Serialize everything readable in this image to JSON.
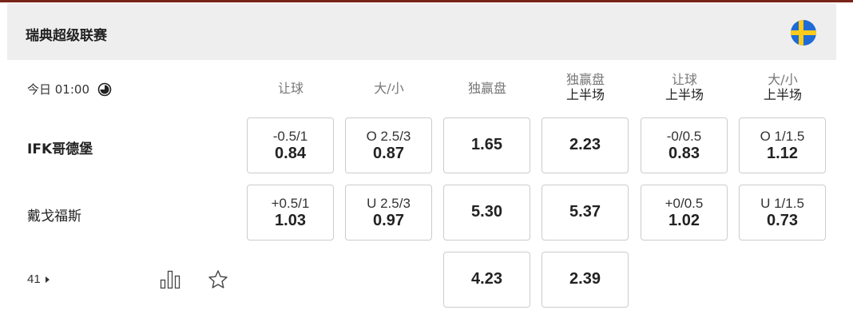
{
  "league": {
    "name": "瑞典超级联赛",
    "flag_icon": "sweden-flag-icon",
    "flag_colors": {
      "blue": "#1e6bd6",
      "yellow": "#fdcb1c"
    }
  },
  "match": {
    "time": "今日 01:00",
    "clock_icon": "clock-icon",
    "home_team": "IFK哥德堡",
    "away_team": "戴戈福斯",
    "more_count": "41",
    "stats_icon": "bar-chart-icon",
    "favorite_icon": "star-icon"
  },
  "columns": [
    {
      "label": "让球",
      "sub": ""
    },
    {
      "label": "大/小",
      "sub": ""
    },
    {
      "label": "独赢盘",
      "sub": ""
    },
    {
      "label": "独赢盘",
      "sub": "上半场"
    },
    {
      "label": "让球",
      "sub": "上半场"
    },
    {
      "label": "大/小",
      "sub": "上半场"
    }
  ],
  "odds": {
    "home": [
      {
        "line": "-0.5/1",
        "value": "0.84"
      },
      {
        "line": "O 2.5/3",
        "value": "0.87"
      },
      {
        "line": "",
        "value": "1.65"
      },
      {
        "line": "",
        "value": "2.23"
      },
      {
        "line": "-0/0.5",
        "value": "0.83"
      },
      {
        "line": "O 1/1.5",
        "value": "1.12"
      }
    ],
    "away": [
      {
        "line": "+0.5/1",
        "value": "1.03"
      },
      {
        "line": "U 2.5/3",
        "value": "0.97"
      },
      {
        "line": "",
        "value": "5.30"
      },
      {
        "line": "",
        "value": "5.37"
      },
      {
        "line": "+0/0.5",
        "value": "1.02"
      },
      {
        "line": "U 1/1.5",
        "value": "0.73"
      }
    ],
    "draw": [
      {
        "value": "4.23"
      },
      {
        "value": "2.39"
      }
    ]
  },
  "colors": {
    "header_bg": "#eeeeee",
    "top_bar": "#7a2418",
    "border": "#cccccc"
  }
}
